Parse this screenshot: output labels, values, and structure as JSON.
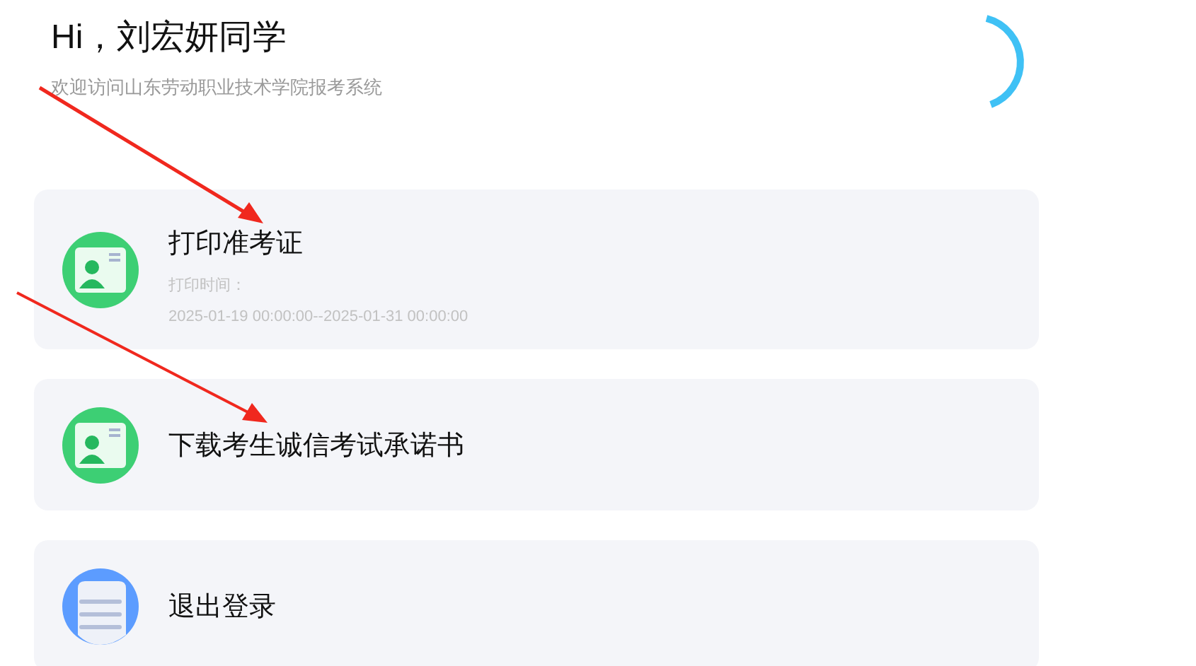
{
  "greeting": "Hi，刘宏妍同学",
  "subtitle": "欢迎访问山东劳动职业技术学院报考系统",
  "menu": [
    {
      "kind": "id-card",
      "title": "打印准考证",
      "details": [
        "打印时间：",
        "2025-01-19 00:00:00--2025-01-31 00:00:00"
      ]
    },
    {
      "kind": "id-card",
      "title": "下载考生诚信考试承诺书"
    },
    {
      "kind": "document",
      "title": "退出登录"
    }
  ]
}
